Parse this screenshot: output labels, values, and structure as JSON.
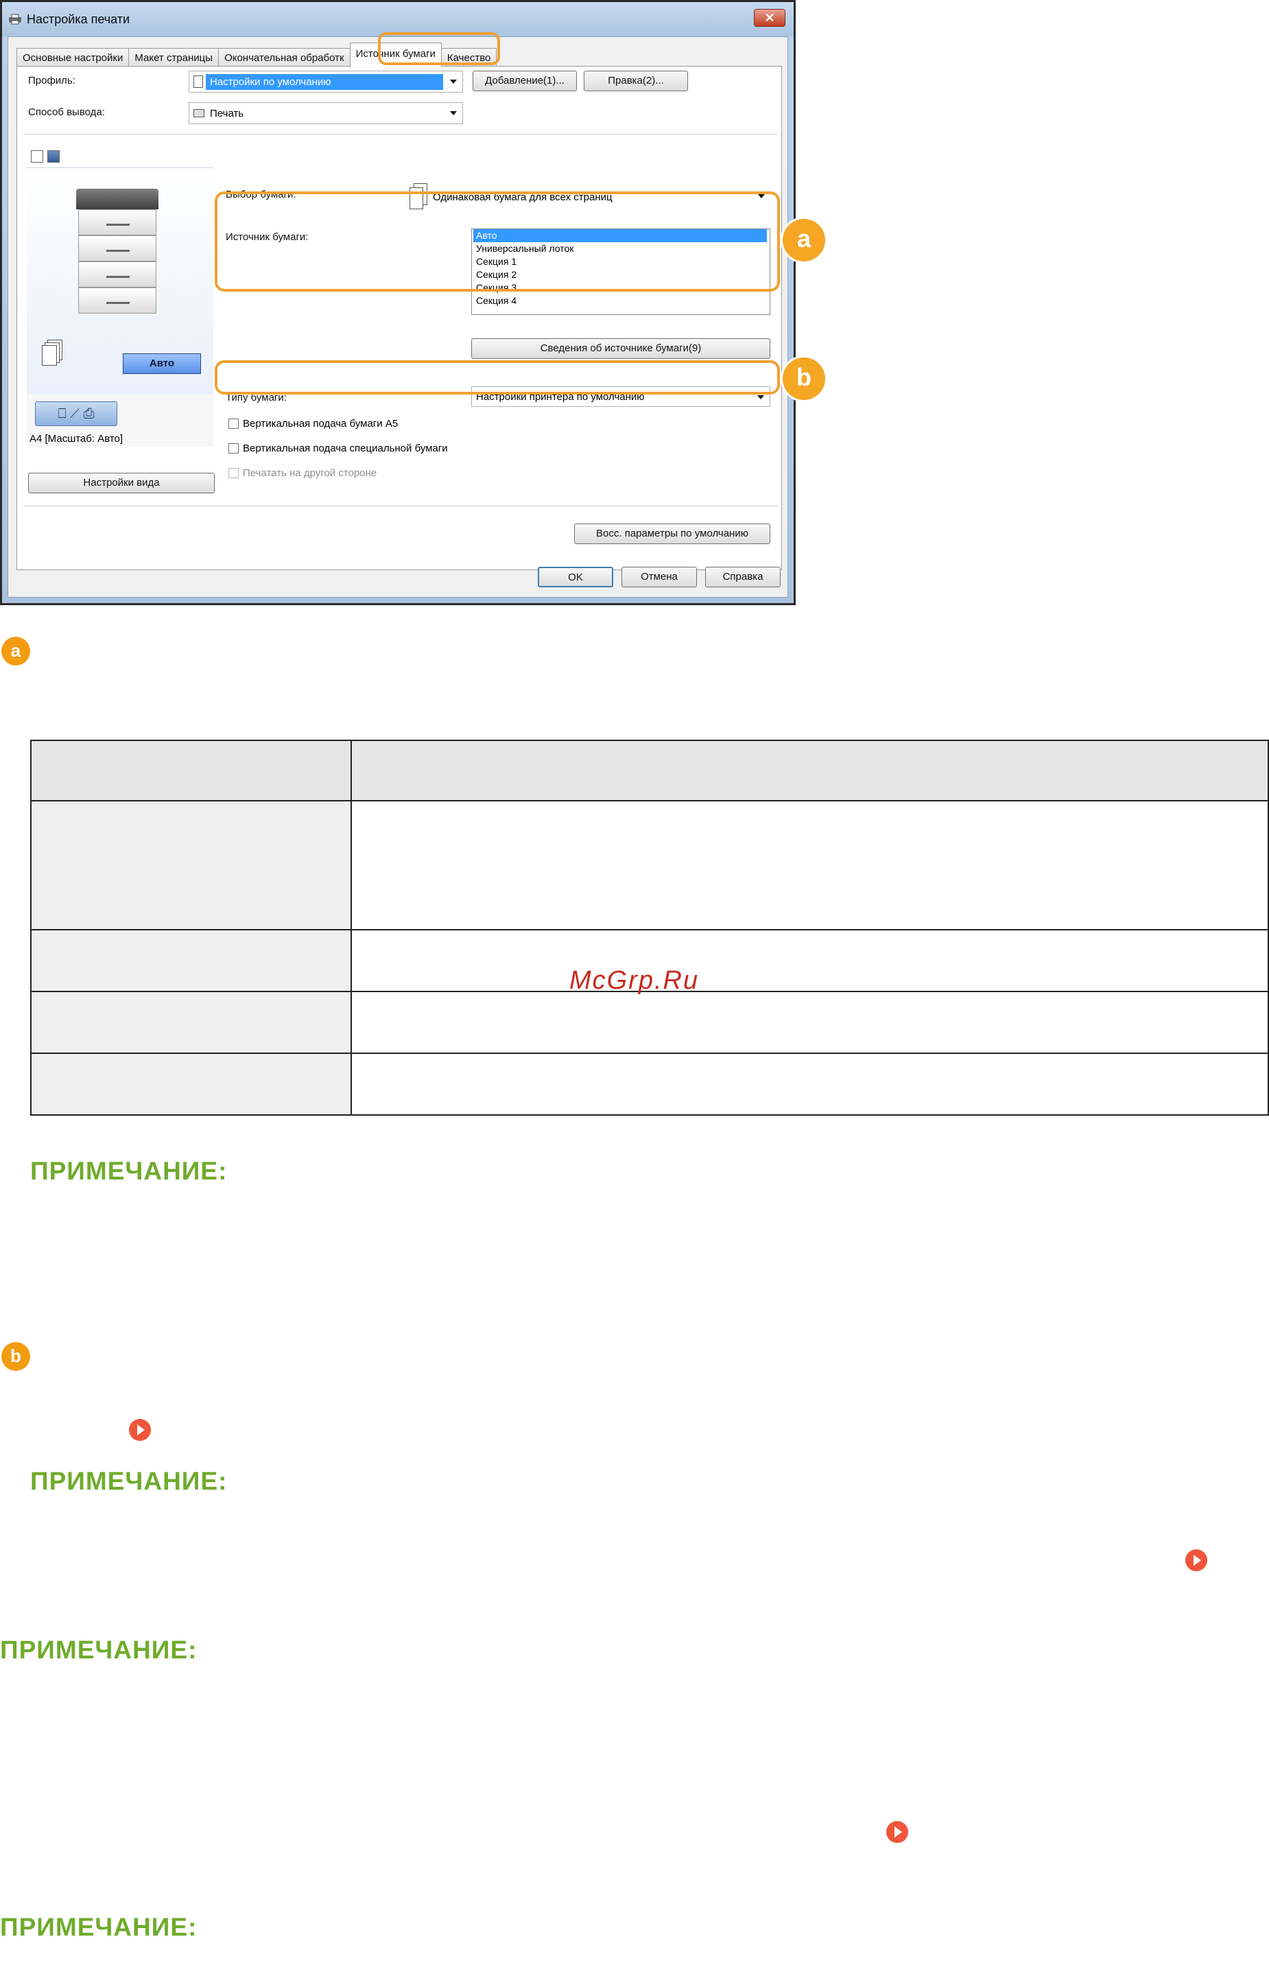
{
  "dialog": {
    "title": "Настройка печати",
    "close_symbol": "✕",
    "tabs": [
      {
        "label": "Основные настройки",
        "active": false
      },
      {
        "label": "Макет страницы",
        "active": false
      },
      {
        "label": "Окончательная обработк",
        "active": false
      },
      {
        "label": "Источник бумаги",
        "active": true
      },
      {
        "label": "Качество",
        "active": false
      }
    ],
    "profile_label": "Профиль:",
    "profile_value": "Настройки по умолчанию",
    "add_button": "Добавление(1)...",
    "edit_button": "Правка(2)...",
    "output_label": "Способ вывода:",
    "output_value": "Печать",
    "paper_selection_label": "Выбор бумаги:",
    "paper_selection_value": "Одинаковая бумага для всех страниц",
    "paper_source_label": "Источник бумаги:",
    "paper_source_options": [
      "Авто",
      "Универсальный лоток",
      "Секция 1",
      "Секция 2",
      "Секция 3",
      "Секция 4"
    ],
    "paper_source_selected": "Авто",
    "paper_source_info_button": "Сведения об источнике бумаги(9)",
    "paper_type_label": "Типу бумаги:",
    "paper_type_value": "Настройки принтера по умолчанию",
    "checkboxes": [
      {
        "label": "Вертикальная подача бумаги А5",
        "checked": false,
        "disabled": false
      },
      {
        "label": "Вертикальная подача специальной бумаги",
        "checked": false,
        "disabled": false
      },
      {
        "label": "Печатать на другой стороне",
        "checked": false,
        "disabled": true
      }
    ],
    "restore_defaults_button": "Восс. параметры по умолчанию",
    "preview_auto_button": "Авто",
    "preview_orientation": "⎕ ⟋ ⎙",
    "preview_caption": "A4 [Масштаб: Авто]",
    "view_settings_button": "Настройки вида",
    "ok_button": "OK",
    "cancel_button": "Отмена",
    "help_button": "Справка",
    "callout_a": "a",
    "callout_b": "b"
  },
  "doc": {
    "mark_a": "a",
    "mark_b": "b",
    "watermark": "McGrp.Ru",
    "note_title": "ПРИМЕЧАНИЕ:"
  },
  "colors": {
    "accent_orange": "#f0a133",
    "note_green": "#6fab2c",
    "link_red": "#f0563c",
    "selection_blue": "#3399ff"
  }
}
